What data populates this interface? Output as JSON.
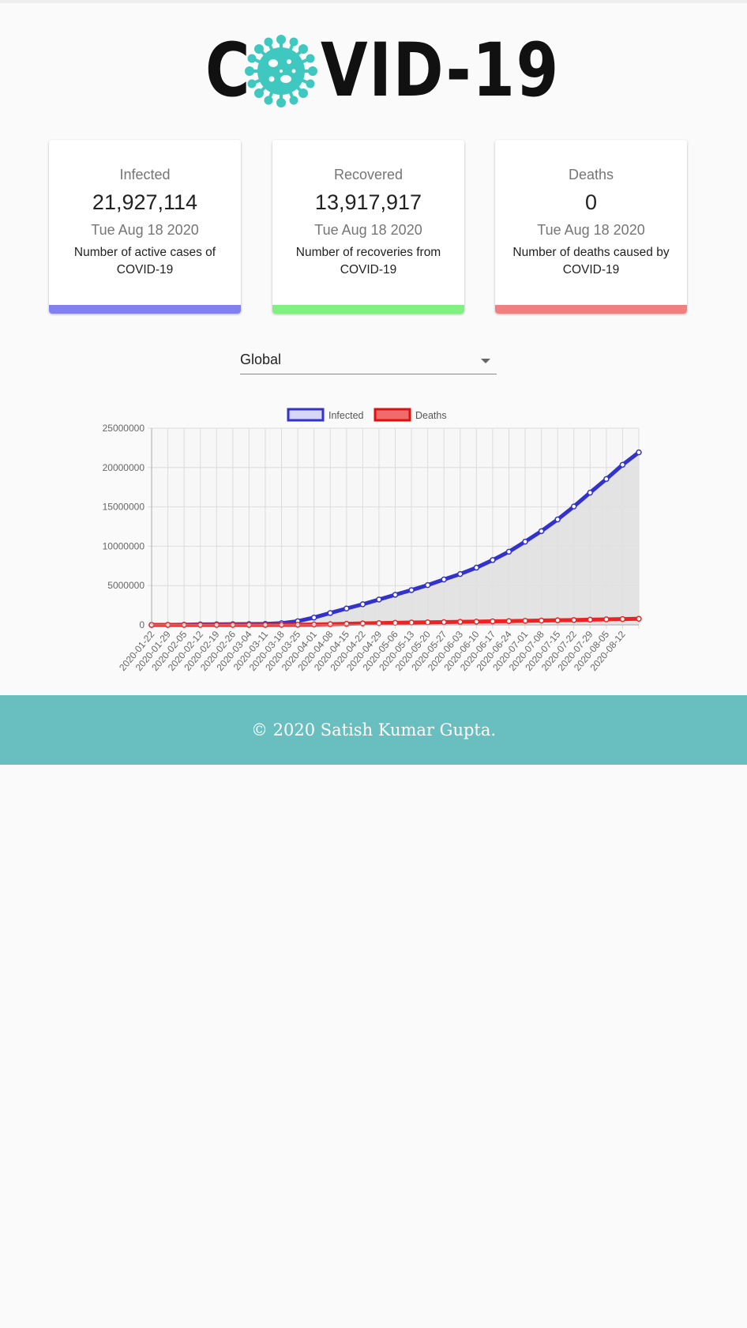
{
  "header": {
    "logo_text_left": "C",
    "logo_text_right": "VID-19",
    "logo_icon": "virus-icon"
  },
  "cards": [
    {
      "title": "Infected",
      "value": "21,927,114",
      "date": "Tue Aug 18 2020",
      "description": "Number of active cases of COVID-19",
      "bar_color": "#8080f0"
    },
    {
      "title": "Recovered",
      "value": "13,917,917",
      "date": "Tue Aug 18 2020",
      "description": "Number of recoveries from COVID-19",
      "bar_color": "#80f080"
    },
    {
      "title": "Deaths",
      "value": "0",
      "date": "Tue Aug 18 2020",
      "description": "Number of deaths caused by COVID-19",
      "bar_color": "#f08080"
    }
  ],
  "country_select": {
    "selected": "Global"
  },
  "chart_data": {
    "type": "line",
    "x_tick_labels": [
      "2020-01-22",
      "2020-01-29",
      "2020-02-05",
      "2020-02-12",
      "2020-02-19",
      "2020-02-26",
      "2020-03-04",
      "2020-03-11",
      "2020-03-18",
      "2020-03-25",
      "2020-04-01",
      "2020-04-08",
      "2020-04-15",
      "2020-04-22",
      "2020-04-29",
      "2020-05-06",
      "2020-05-13",
      "2020-05-20",
      "2020-05-27",
      "2020-06-03",
      "2020-06-10",
      "2020-06-17",
      "2020-06-24",
      "2020-07-01",
      "2020-07-08",
      "2020-07-15",
      "2020-07-22",
      "2020-07-29",
      "2020-08-05",
      "2020-08-12"
    ],
    "y_ticks": [
      0,
      5000000,
      10000000,
      15000000,
      20000000,
      25000000
    ],
    "ylim": [
      0,
      25000000
    ],
    "grid": true,
    "legend_position": "top-center",
    "series": [
      {
        "name": "Infected",
        "color": "#3333cc",
        "fill": "#e0e0e0",
        "values": [
          555,
          6166,
          28276,
          60371,
          75641,
          82294,
          95120,
          126660,
          214910,
          467594,
          932605,
          1511104,
          2084209,
          2624512,
          3226700,
          3831301,
          4422910,
          5060398,
          5771250,
          6466432,
          7273971,
          8239480,
          9298541,
          10580000,
          11915000,
          13400000,
          15045000,
          16810000,
          18540000,
          20350000,
          21927114
        ]
      },
      {
        "name": "Deaths",
        "color": "#ee2222",
        "fill": "#ee2222",
        "values": [
          17,
          133,
          565,
          1370,
          2247,
          2803,
          3348,
          4720,
          9278,
          21181,
          46895,
          88371,
          134179,
          183027,
          228739,
          264150,
          297153,
          326459,
          354000,
          385000,
          415000,
          446000,
          480000,
          514000,
          550000,
          586000,
          620000,
          659000,
          700000,
          740000,
          775000
        ]
      }
    ]
  },
  "footer": {
    "text": "© 2020 Satish Kumar Gupta."
  }
}
